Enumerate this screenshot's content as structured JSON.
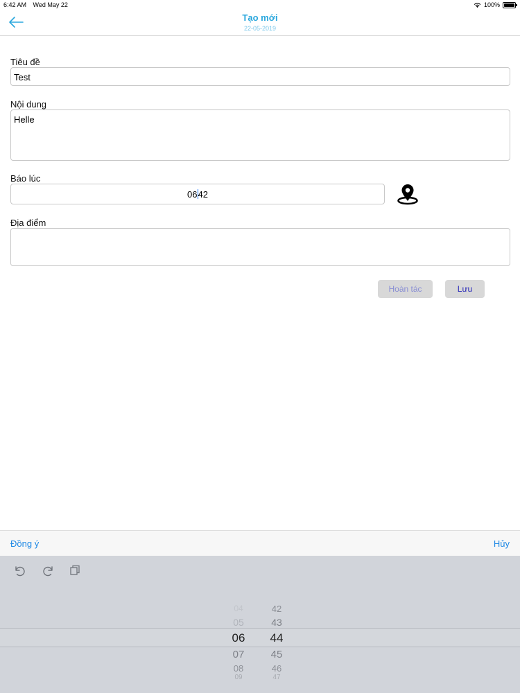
{
  "status_bar": {
    "time": "6:42 AM",
    "date": "Wed May 22",
    "battery": "100%"
  },
  "nav": {
    "title": "Tạo mới",
    "subtitle": "22-05-2019"
  },
  "form": {
    "title_label": "Tiêu đề",
    "title_value": "Test",
    "content_label": "Nội dung",
    "content_value": "Helle",
    "alarm_label": "Báo lúc",
    "alarm_hour": "06",
    "alarm_minute": "42",
    "location_label": "Địa điểm",
    "location_value": ""
  },
  "buttons": {
    "undo": "Hoàn tác",
    "save": "Lưu"
  },
  "picker_toolbar": {
    "agree": "Đồng ý",
    "cancel": "Hủy"
  },
  "picker": {
    "hours": [
      "04",
      "05",
      "06",
      "07",
      "08",
      "09"
    ],
    "minutes": [
      "42",
      "43",
      "44",
      "45",
      "46",
      "47"
    ]
  },
  "colors": {
    "accent": "#2aa7dd",
    "toolbar_link": "#1e88e5",
    "keyboard_bg": "#d1d4da"
  }
}
